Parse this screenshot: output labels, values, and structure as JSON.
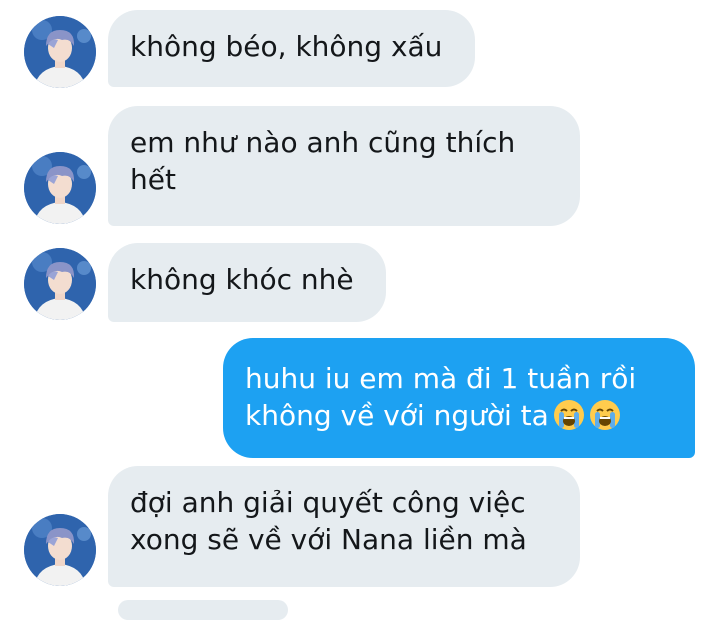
{
  "conversation": {
    "messages": [
      {
        "sender": "other",
        "text": "không béo, không xấu"
      },
      {
        "sender": "other",
        "text": "em như nào anh cũng thích hết"
      },
      {
        "sender": "other",
        "text": "không khóc nhè"
      },
      {
        "sender": "me",
        "text": "huhu iu em mà đi 1 tuần rồi không về với người ta",
        "emoji": [
          "loudly-crying-face",
          "loudly-crying-face"
        ]
      },
      {
        "sender": "other",
        "text": "đợi anh giải quyết công việc xong sẽ về với Nana liền mà"
      }
    ]
  },
  "colors": {
    "incoming_bubble": "#e6ecf0",
    "outgoing_bubble": "#1da1f2",
    "text_dark": "#14171a",
    "text_light": "#ffffff"
  }
}
